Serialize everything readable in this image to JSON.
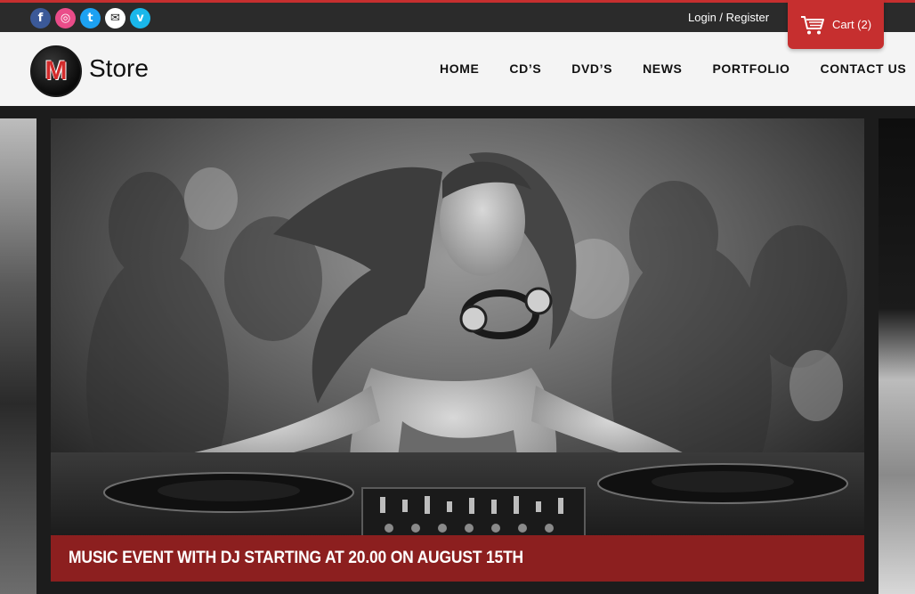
{
  "social": [
    {
      "icon": "facebook-icon",
      "glyph": "f",
      "color": "#3b5998"
    },
    {
      "icon": "dribbble-icon",
      "glyph": "◎",
      "color": "#ea4c89"
    },
    {
      "icon": "twitter-icon",
      "glyph": "t",
      "color": "#1da1f2"
    },
    {
      "icon": "mail-icon",
      "glyph": "✉",
      "color": "#ffffff"
    },
    {
      "icon": "vimeo-icon",
      "glyph": "v",
      "color": "#1ab7ea"
    }
  ],
  "topbar": {
    "login_label": "Login",
    "separator": " / ",
    "register_label": "Register"
  },
  "cart": {
    "icon": "cart-icon",
    "label": "Cart (2)"
  },
  "logo": {
    "mark": "M",
    "text": "Store"
  },
  "nav": {
    "items": [
      {
        "label": "HOME"
      },
      {
        "label": "CD’S"
      },
      {
        "label": "DVD’S"
      },
      {
        "label": "NEWS"
      },
      {
        "label": "PORTFOLIO"
      },
      {
        "label": "CONTACT US"
      }
    ]
  },
  "slider": {
    "caption": "MUSIC EVENT WITH DJ STARTING AT 20.00 ON AUGUST 15TH"
  },
  "colors": {
    "accent": "#c62f2f",
    "caption_bg": "#8c1f1f",
    "topbar_bg": "#2b2b2b",
    "header_bg": "#f4f4f4"
  }
}
